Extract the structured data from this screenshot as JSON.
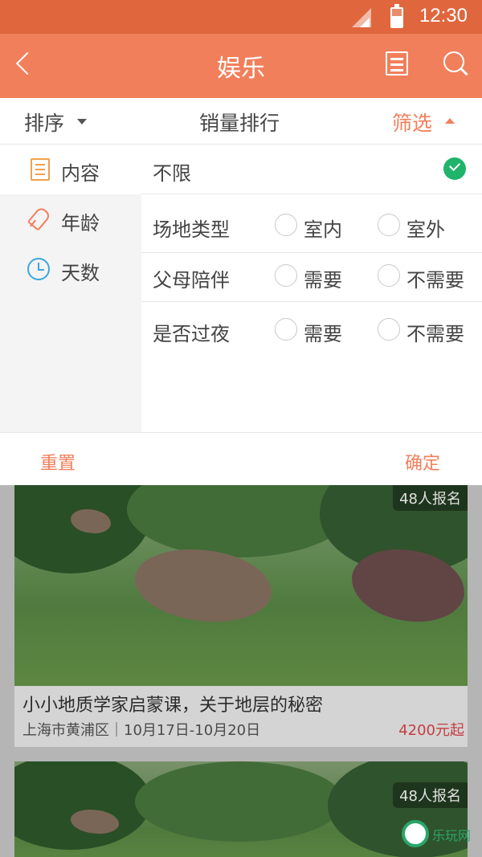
{
  "status": {
    "time": "12:30"
  },
  "header": {
    "title": "娱乐",
    "calendar_icon": "calendar-icon",
    "search_icon": "search-icon",
    "back_icon": "back-arrow-icon"
  },
  "sortbar": {
    "sort": "排序",
    "sales": "销量排行",
    "filter": "筛选"
  },
  "filter": {
    "categories": [
      {
        "label": "内容",
        "icon": "document-list-icon",
        "active": true
      },
      {
        "label": "年龄",
        "icon": "popsicle-icon",
        "active": false
      },
      {
        "label": "天数",
        "icon": "clock-icon",
        "active": false
      }
    ],
    "unlimited": "不限",
    "rows": [
      {
        "name": "场地类型",
        "options": [
          "室内",
          "室外"
        ]
      },
      {
        "name": "父母陪伴",
        "options": [
          "需要",
          "不需要"
        ]
      },
      {
        "name": "是否过夜",
        "options": [
          "需要",
          "不需要"
        ]
      }
    ],
    "reset": "重置",
    "confirm": "确定"
  },
  "cards": [
    {
      "badge": "48人报名",
      "title": "小小地质学家启蒙课，关于地层的秘密",
      "location": "上海市黄浦区｜10月17日-10月20日",
      "price": "4200元起"
    },
    {
      "badge": "48人报名"
    }
  ],
  "watermark": {
    "text": "乐玩网"
  },
  "colors": {
    "accent": "#f27f5b",
    "statusbar": "#e0663e",
    "check": "#20b36b",
    "price": "#e0474c"
  }
}
